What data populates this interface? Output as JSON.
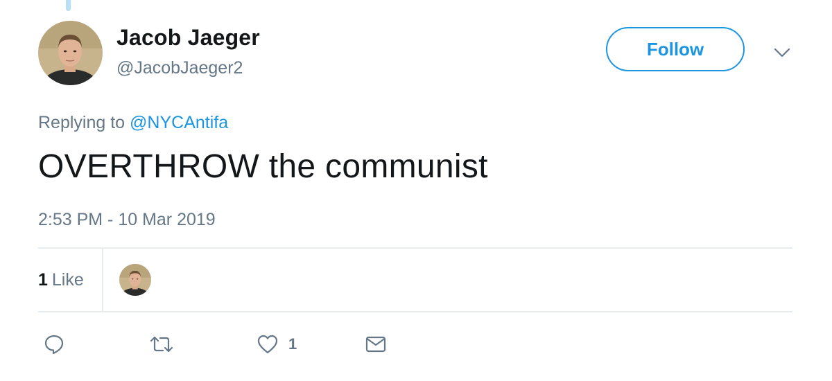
{
  "tweet": {
    "author": {
      "display_name": "Jacob Jaeger",
      "handle": "@JacobJaeger2"
    },
    "follow_label": "Follow",
    "replying_prefix": "Replying to",
    "replying_to": "@NYCAntifa",
    "text": "OVERTHROW the communist",
    "timestamp": "2:53 PM - 10 Mar 2019",
    "stats": {
      "likes_count": "1",
      "likes_label": "Like"
    },
    "actions": {
      "like_count": "1"
    }
  },
  "colors": {
    "accent": "#1b95e0",
    "secondary_text": "#657786",
    "primary_text": "#14171a",
    "divider": "#e6ecf0",
    "thread_line": "#b9dff3"
  },
  "icons": {
    "reply": "reply-icon",
    "retweet": "retweet-icon",
    "like": "heart-icon",
    "message": "envelope-icon",
    "more": "chevron-down-icon"
  }
}
